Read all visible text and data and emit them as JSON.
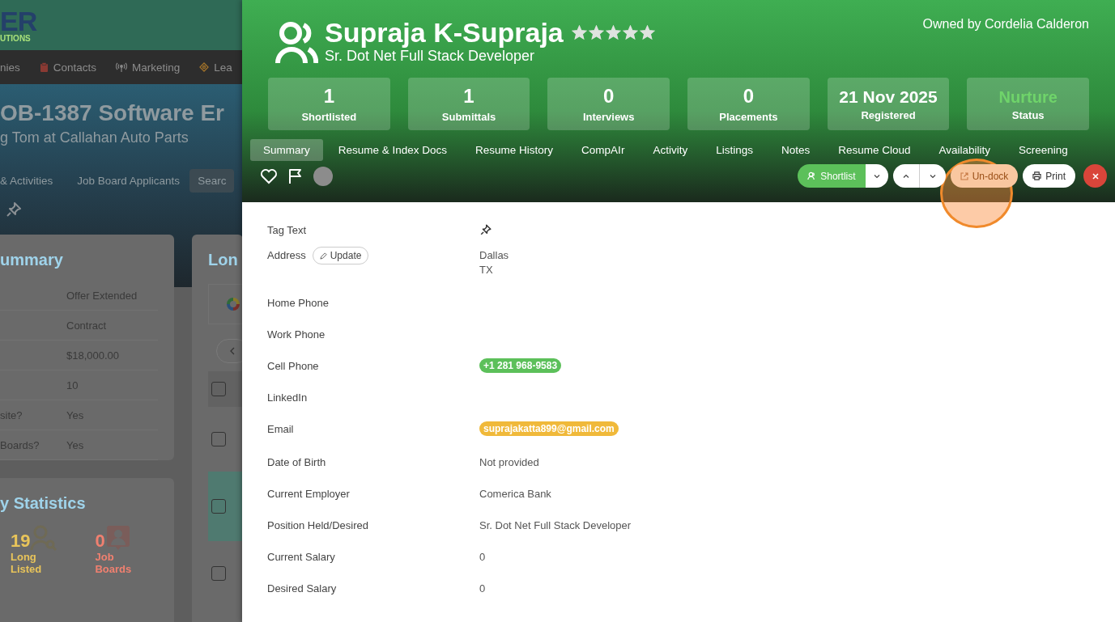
{
  "background_page": {
    "logo": {
      "text": "ER",
      "tagline": "UTIONS"
    },
    "nav": [
      {
        "label": "nies"
      },
      {
        "label": "Contacts"
      },
      {
        "label": "Marketing"
      },
      {
        "label": "Lea"
      }
    ],
    "title": "OB-1387 Software Er",
    "subtitle": "g Tom at Callahan Auto Parts",
    "tabs": [
      {
        "label": "& Activities",
        "selected": false
      },
      {
        "label": "Job Board Applicants",
        "selected": false
      },
      {
        "label": "Searc",
        "selected": true
      }
    ],
    "summary_card": {
      "title": "ummary",
      "rows": [
        {
          "value": "Offer Extended"
        },
        {
          "value": "Contract"
        },
        {
          "value": "$18,000.00"
        },
        {
          "value": "10"
        },
        {
          "label": "site?",
          "value": "Yes"
        },
        {
          "label": "Boards?",
          "value": "Yes"
        }
      ]
    },
    "statistics_card": {
      "title": "y Statistics",
      "stats": [
        {
          "value": "19",
          "label": "Long Listed",
          "color": "#e8c45a"
        },
        {
          "value": "0",
          "label": "Job Boards",
          "color": "#f08070"
        }
      ]
    },
    "list_card": {
      "title": "Lon",
      "rows": [
        {
          "checked": false,
          "selected": false
        },
        {
          "checked": false,
          "selected": false
        },
        {
          "checked": false,
          "selected": true
        },
        {
          "checked": false,
          "selected": false
        }
      ]
    }
  },
  "panel": {
    "name": "Supraja K-Supraja",
    "stars": 5,
    "headline": "Sr. Dot Net Full Stack Developer",
    "owner": "Owned by Cordelia Calderon",
    "stats": [
      {
        "value": "1",
        "label": "Shortlisted",
        "kind": "count"
      },
      {
        "value": "1",
        "label": "Submittals",
        "kind": "count"
      },
      {
        "value": "0",
        "label": "Interviews",
        "kind": "count"
      },
      {
        "value": "0",
        "label": "Placements",
        "kind": "count"
      },
      {
        "value": "21 Nov 2025",
        "label": "Registered",
        "kind": "date"
      },
      {
        "value": "Nurture",
        "label": "Status",
        "kind": "status"
      }
    ],
    "tabs": [
      {
        "label": "Summary",
        "selected": true
      },
      {
        "label": "Resume & Index Docs",
        "selected": false
      },
      {
        "label": "Resume History",
        "selected": false
      },
      {
        "label": "CompAIr",
        "selected": false
      },
      {
        "label": "Activity",
        "selected": false
      },
      {
        "label": "Listings",
        "selected": false
      },
      {
        "label": "Notes",
        "selected": false
      },
      {
        "label": "Resume Cloud",
        "selected": false
      },
      {
        "label": "Availability",
        "selected": false
      },
      {
        "label": "Screening",
        "selected": false
      }
    ],
    "favorite": false,
    "flagged": false,
    "actions": [
      {
        "label": "Shortlist",
        "kind": "split",
        "highlighted": false
      },
      {
        "kind": "updown",
        "highlighted": false
      },
      {
        "label": "Un-dock",
        "kind": "undock",
        "highlighted": true
      },
      {
        "label": "Print",
        "kind": "print",
        "highlighted": false
      },
      {
        "kind": "close",
        "highlighted": false
      }
    ],
    "fields": [
      {
        "label": "Tag Text",
        "kind": "pin"
      },
      {
        "label": "Address",
        "kind": "address",
        "action": "Update",
        "lines": [
          "Dallas",
          "TX"
        ]
      },
      {
        "label": "Home Phone",
        "kind": "text"
      },
      {
        "label": "Work Phone",
        "kind": "text"
      },
      {
        "label": "Cell Phone",
        "kind": "phone",
        "value": "+1 281 968-9583"
      },
      {
        "label": "LinkedIn",
        "kind": "text"
      },
      {
        "label": "Email",
        "kind": "email",
        "value": "suprajakatta899@gmail.com"
      },
      {
        "label": "Date of Birth",
        "kind": "text",
        "value": "Not provided"
      },
      {
        "label": "Current Employer",
        "kind": "text",
        "value": "Comerica Bank"
      },
      {
        "label": "Position Held/Desired",
        "kind": "text",
        "value": "Sr. Dot Net Full Stack Developer"
      },
      {
        "label": "Current Salary",
        "kind": "text",
        "value": "0"
      },
      {
        "label": "Desired Salary",
        "kind": "text",
        "value": "0"
      }
    ]
  }
}
